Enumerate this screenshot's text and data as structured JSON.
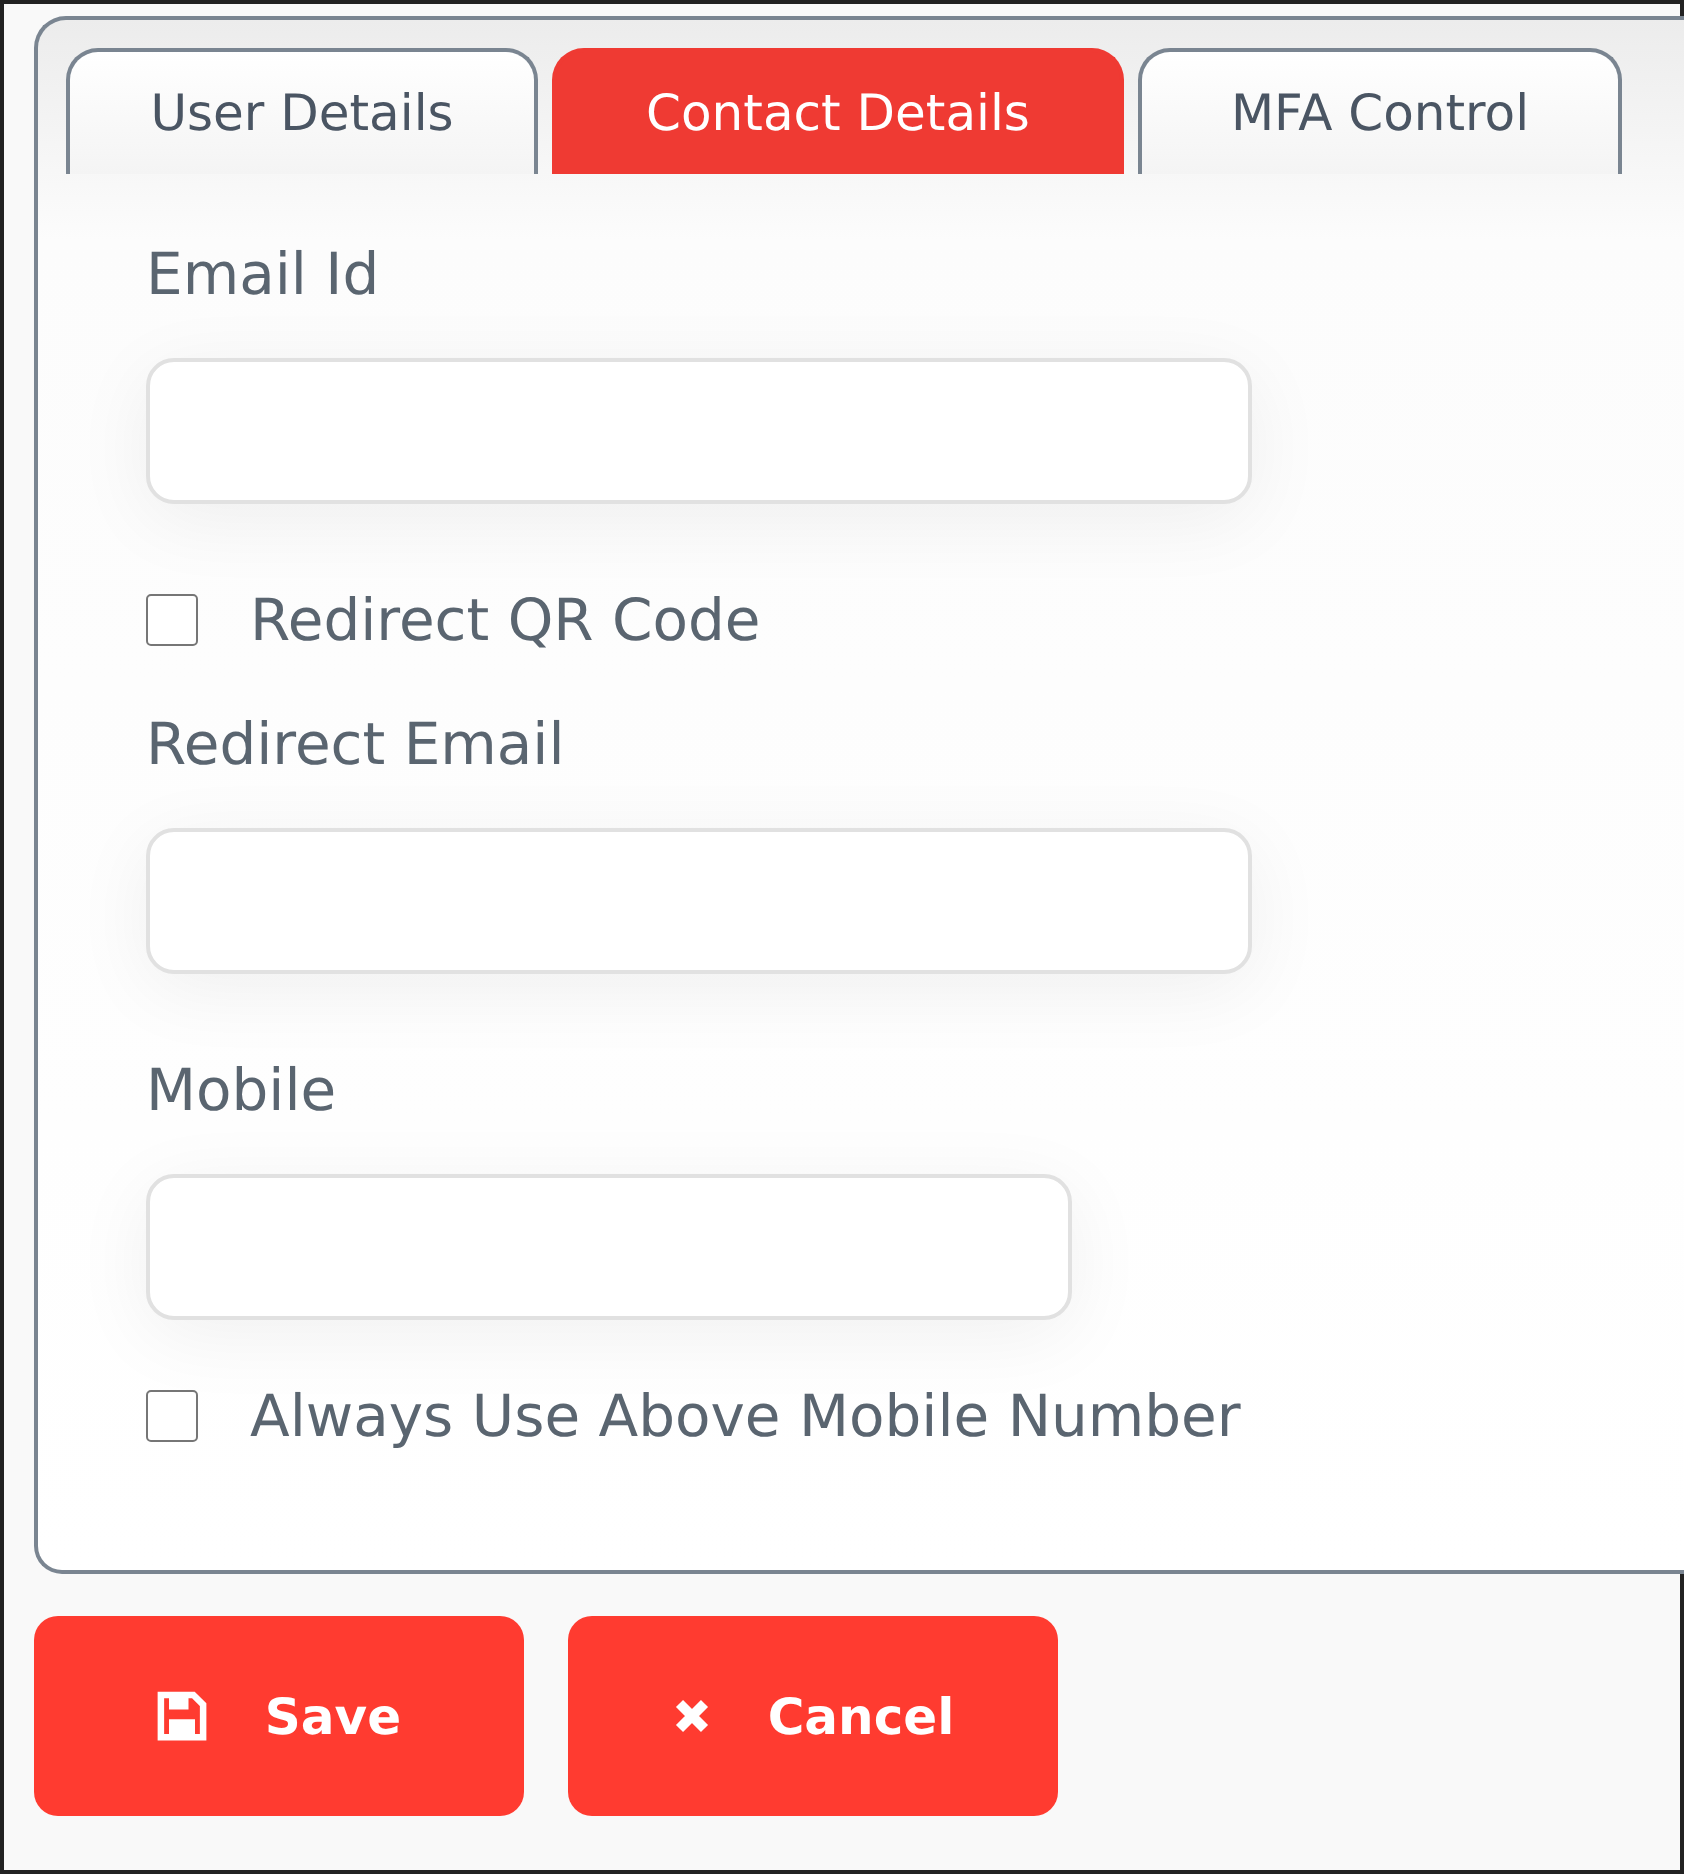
{
  "tabs": [
    {
      "label": "User Details",
      "selected": false
    },
    {
      "label": "Contact Details",
      "selected": true
    },
    {
      "label": "MFA Control",
      "selected": false
    }
  ],
  "form": [
    {
      "kind": "field",
      "label": "Email Id"
    },
    {
      "kind": "checkbox",
      "label": "Redirect QR Code",
      "checked": false
    },
    {
      "kind": "field",
      "label": "Redirect Email"
    },
    {
      "kind": "short_field",
      "label": "Mobile"
    },
    {
      "kind": "checkbox",
      "label": "Always Use Above Mobile Number",
      "checked": false
    }
  ],
  "buttons": [
    {
      "kind": "save",
      "label": "Save"
    },
    {
      "kind": "cancel",
      "label": "Cancel"
    }
  ]
}
